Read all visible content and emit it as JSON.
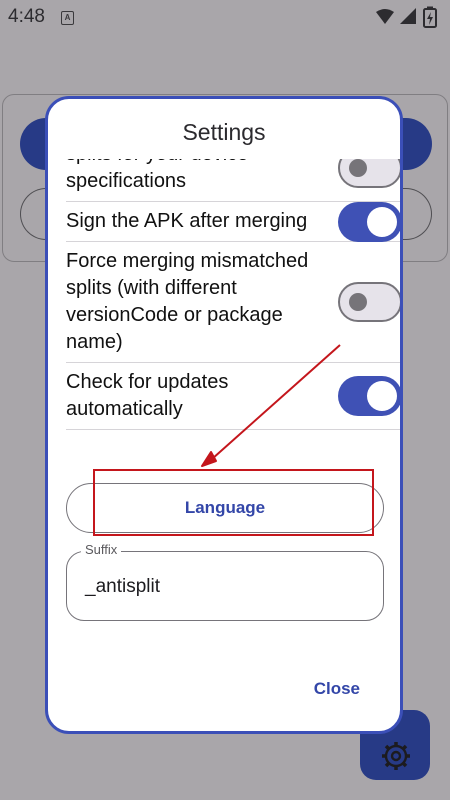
{
  "status_bar": {
    "time": "4:48",
    "notification_badge": "A",
    "icons": [
      "wifi-icon",
      "signal-icon",
      "battery-charging-icon"
    ]
  },
  "dialog": {
    "title": "Settings",
    "settings": [
      {
        "label": "splits for your device specifications",
        "enabled": false
      },
      {
        "label": "Sign the APK after merging",
        "enabled": true
      },
      {
        "label": "Force merging mismatched splits (with different versionCode or package name)",
        "enabled": false
      },
      {
        "label": "Check for updates automatically",
        "enabled": true
      }
    ],
    "language_button": "Language",
    "suffix_field": {
      "label": "Suffix",
      "value": "_antisplit"
    },
    "close_button": "Close"
  },
  "colors": {
    "accent": "#3f51b5",
    "dialog_border": "#3b4fb8",
    "annotation_red": "#c4161c",
    "scrim": "#a9a6aa"
  },
  "background_app": {
    "fab_icon": "gear-icon"
  }
}
